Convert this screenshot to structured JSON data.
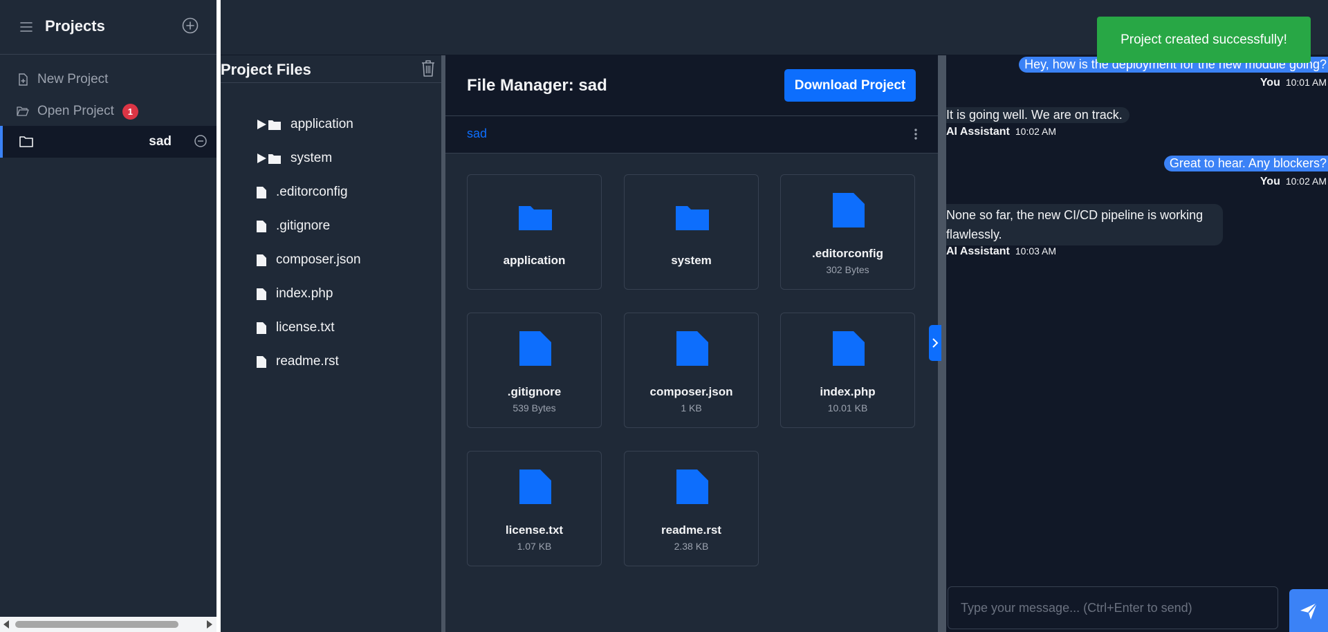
{
  "sidebar": {
    "title": "Projects",
    "items": [
      {
        "label": "New Project",
        "icon": "file-plus-icon"
      },
      {
        "label": "Open Project",
        "icon": "folder-open-icon",
        "badge": "1"
      }
    ],
    "projects": [
      {
        "name": "sad"
      }
    ]
  },
  "files_panel": {
    "title": "Project Files",
    "tree": [
      {
        "name": "application",
        "type": "folder"
      },
      {
        "name": "system",
        "type": "folder"
      },
      {
        "name": ".editorconfig",
        "type": "file"
      },
      {
        "name": ".gitignore",
        "type": "file"
      },
      {
        "name": "composer.json",
        "type": "file"
      },
      {
        "name": "index.php",
        "type": "file"
      },
      {
        "name": "license.txt",
        "type": "file"
      },
      {
        "name": "readme.rst",
        "type": "file"
      }
    ]
  },
  "file_manager": {
    "title": "File Manager: sad",
    "download_label": "Download Project",
    "breadcrumb": "sad",
    "cards": [
      {
        "name": "application",
        "size": ""
      },
      {
        "name": "system",
        "size": ""
      },
      {
        "name": ".editorconfig",
        "size": "302 Bytes"
      },
      {
        "name": ".gitignore",
        "size": "539 Bytes"
      },
      {
        "name": "composer.json",
        "size": "1 KB"
      },
      {
        "name": "index.php",
        "size": "10.01 KB"
      },
      {
        "name": "license.txt",
        "size": "1.07 KB"
      },
      {
        "name": "readme.rst",
        "size": "2.38 KB"
      }
    ]
  },
  "chat": {
    "messages": [
      {
        "sender": "You",
        "time": "10:01 AM",
        "text": "Hey, how is the deployment for the new module going?"
      },
      {
        "sender": "AI Assistant",
        "time": "10:02 AM",
        "text": "It is going well. We are on track."
      },
      {
        "sender": "You",
        "time": "10:02 AM",
        "text": "Great to hear. Any blockers?"
      },
      {
        "sender": "AI Assistant",
        "time": "10:03 AM",
        "text": "None so far, the new CI/CD pipeline is working flawlessly."
      }
    ],
    "input_placeholder": "Type your message... (Ctrl+Enter to send)"
  },
  "toast": {
    "text": "Project created successfully!"
  },
  "colors": {
    "accent": "#0d6efd",
    "chat_bubble_user": "#3b82f6",
    "toast_success": "#28a745",
    "badge": "#dc3545",
    "sidebar_bg": "#1f2937",
    "panel_bg": "#111827"
  }
}
